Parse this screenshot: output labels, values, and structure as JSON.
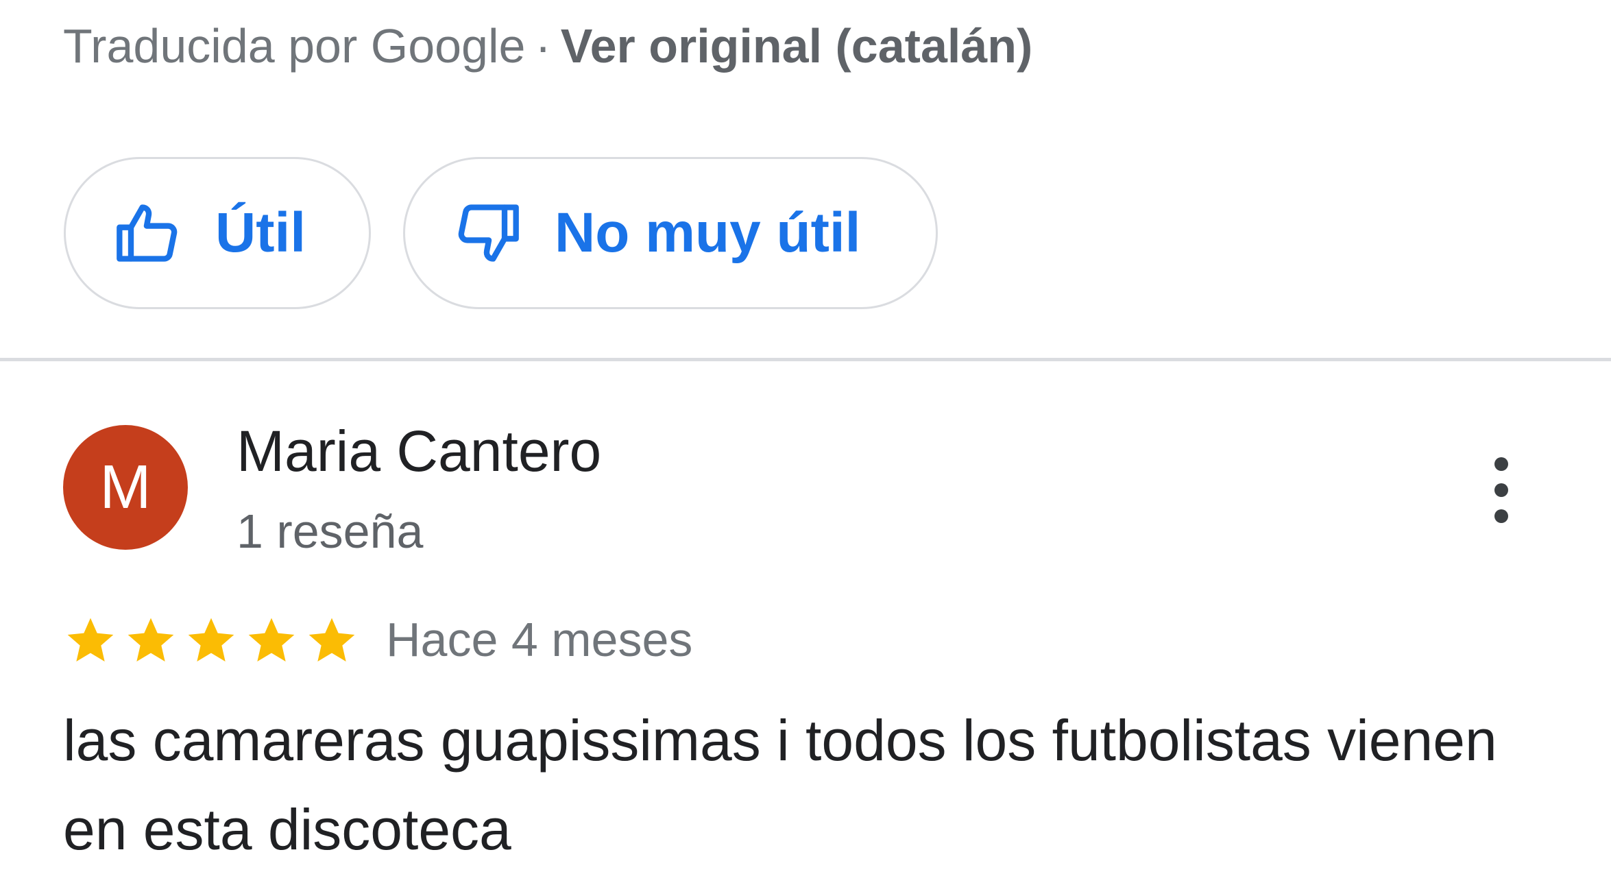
{
  "translation": {
    "translated_by": "Traducida por Google",
    "separator": "·",
    "view_original": "Ver original (catalán)"
  },
  "feedback": {
    "helpful_label": "Útil",
    "helpful_icon": "thumbs-up-icon",
    "not_helpful_label": "No muy útil",
    "not_helpful_icon": "thumbs-down-icon",
    "accent_color": "#1a73e8"
  },
  "review": {
    "avatar_initial": "M",
    "avatar_color": "#c53e1c",
    "author_name": "Maria Cantero",
    "review_count": "1 reseña",
    "menu_icon": "more-vert-icon",
    "rating": 5,
    "rating_max": 5,
    "star_color": "#fbbc04",
    "time_ago": "Hace 4 meses",
    "text": "las camareras guapissimas i todos los futbolistas vienen en esta discoteca"
  }
}
